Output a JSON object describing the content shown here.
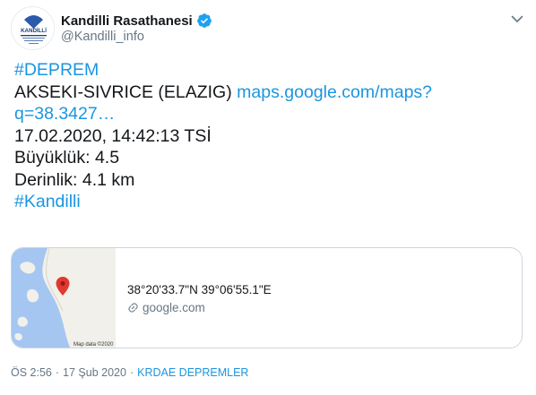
{
  "author": {
    "display_name": "Kandilli Rasathanesi",
    "handle": "@Kandilli_info",
    "avatar_text": "KANDİLLİ",
    "avatar_icon": "observatory-logo",
    "verified_icon": "verified-badge-icon"
  },
  "tweet": {
    "hashtag_top": "#DEPREM",
    "location": "AKSEKI-SIVRICE (ELAZIG)",
    "link_line1": "maps.google.com/maps?",
    "link_line2": "q=38.3427…",
    "datetime": "17.02.2020, 14:42:13 TSİ",
    "magnitude": "Büyüklük: 4.5",
    "depth": "Derinlik: 4.1 km",
    "hashtag_bottom": "#Kandilli"
  },
  "card": {
    "coordinates": "38°20'33.7\"N 39°06'55.1\"E",
    "domain": "google.com",
    "map_credit": "Map data ©2020"
  },
  "meta": {
    "time": "ÖS 2:56",
    "separator": "·",
    "date": "17 Şub 2020",
    "source": "KRDAE DEPREMLER"
  },
  "colors": {
    "link": "#1b95e0",
    "secondary_text": "#657786",
    "map_water": "#a4c6f0",
    "map_land": "#f1f0ea",
    "pin": "#e03a30"
  }
}
